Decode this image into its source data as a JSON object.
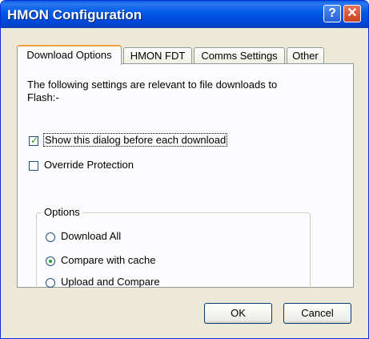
{
  "window": {
    "title": "HMON Configuration"
  },
  "titlebar": {
    "help_label": "?",
    "close_label": "✕"
  },
  "tabs": [
    {
      "label": "Download Options",
      "active": true
    },
    {
      "label": "HMON FDT",
      "active": false
    },
    {
      "label": "Comms Settings",
      "active": false
    },
    {
      "label": "Other",
      "active": false
    }
  ],
  "download_options": {
    "description_line1": "The following settings are relevant to file downloads to",
    "description_line2": "Flash:-",
    "show_dialog": {
      "label": "Show this dialog before each download",
      "checked": true
    },
    "override_protection": {
      "label": "Override Protection",
      "checked": false
    },
    "options_group": {
      "label": "Options",
      "items": [
        {
          "label": "Download All",
          "selected": false
        },
        {
          "label": "Compare with cache",
          "selected": true
        },
        {
          "label": "Upload and Compare",
          "selected": false
        }
      ]
    }
  },
  "buttons": {
    "ok_label": "OK",
    "cancel_label": "Cancel"
  },
  "colors": {
    "titlebar": "#0058e6",
    "face": "#ece9d8",
    "active_tab_accent": "#f4a33a",
    "check_mark": "#21a121"
  }
}
